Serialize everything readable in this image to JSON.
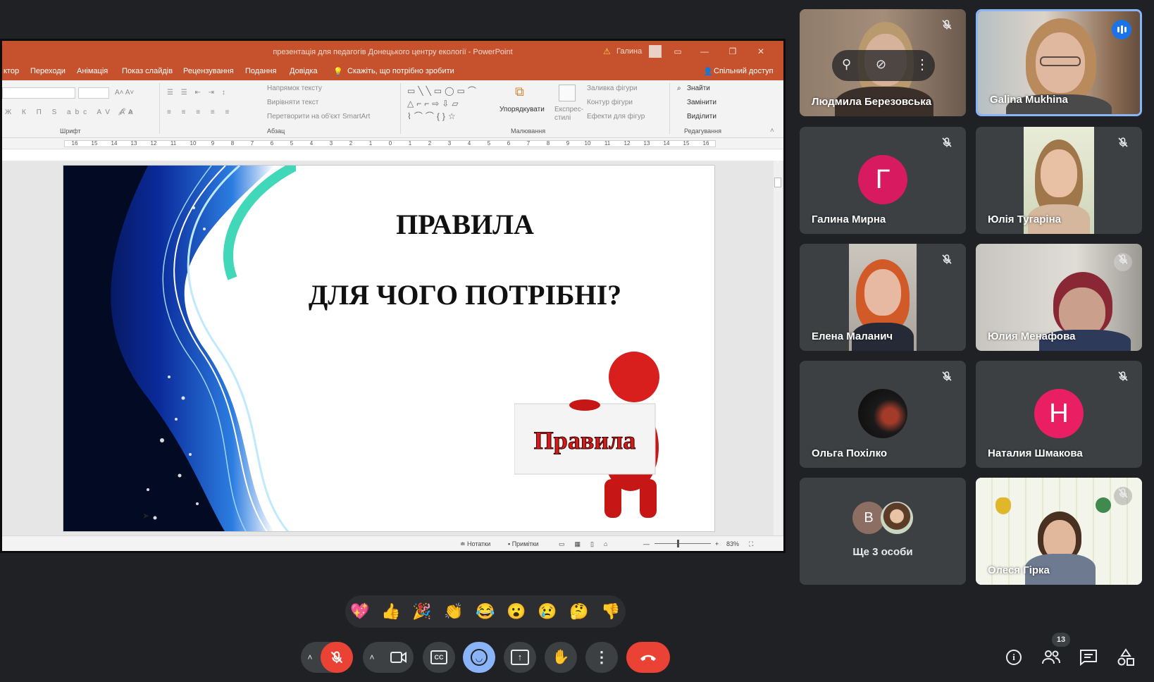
{
  "powerpoint": {
    "doc_title": "презентація для педагогів Донецького центру екології  -  PowerPoint",
    "user": "Галина",
    "menu": [
      "ктор",
      "Переходи",
      "Анімація",
      "Показ слайдів",
      "Рецензування",
      "Подання",
      "Довідка"
    ],
    "tell_me": "Скажіть, що потрібно зробити",
    "share": "Спільний доступ",
    "ribbon": {
      "group_font": "Шрифт",
      "group_paragraph": "Абзац",
      "group_drawing": "Малювання",
      "group_editing": "Редагування",
      "text_direction": "Напрямок тексту",
      "align_text": "Вирівняти текст",
      "smartart": "Перетворити на об'єкт SmartArt",
      "arrange": "Упорядкувати",
      "quick_styles": "Експрес-стилі",
      "shape_fill": "Заливка фігури",
      "shape_outline": "Контур фігури",
      "shape_effects": "Ефекти для фігур",
      "find": "Знайти",
      "replace": "Замінити",
      "select": "Виділити"
    },
    "ruler_ticks": [
      "16",
      "15",
      "14",
      "13",
      "12",
      "11",
      "10",
      "9",
      "8",
      "7",
      "6",
      "5",
      "4",
      "3",
      "2",
      "1",
      "0",
      "1",
      "2",
      "3",
      "4",
      "5",
      "6",
      "7",
      "8",
      "9",
      "10",
      "11",
      "12",
      "13",
      "14",
      "15",
      "16"
    ],
    "slide": {
      "title": "ПРАВИЛА",
      "question": "ДЛЯ ЧОГО ПОТРІБНІ?",
      "sign": "Правила"
    },
    "status": {
      "notes": "Нотатки",
      "comments": "Примітки",
      "zoom": "83%"
    }
  },
  "participants": [
    {
      "name": "Людмила Березовська",
      "muted": true,
      "pinned_controls": true
    },
    {
      "name": "Galina Mukhina",
      "speaking": true
    },
    {
      "name": "Галина Мирна",
      "letter": "Г",
      "color": "#d81b60",
      "muted": true
    },
    {
      "name": "Юлія Тугаріна",
      "muted": true
    },
    {
      "name": "Елена Маланич",
      "muted": true
    },
    {
      "name": "Юлия Менафова",
      "muted": true
    },
    {
      "name": "Ольга Похілко",
      "muted": true
    },
    {
      "name": "Наталия Шмакова",
      "letter": "Н",
      "color": "#e91e63",
      "muted": true
    },
    {
      "name": "Ще 3 особи",
      "letter": "В",
      "color": "#8d6e63"
    },
    {
      "name": "Олеся Гірка"
    }
  ],
  "reactions": [
    "💖",
    "👍",
    "🎉",
    "👏",
    "😂",
    "😮",
    "😢",
    "🤔",
    "👎"
  ],
  "controls": {
    "participant_count": "13",
    "icons": [
      "mic-off-icon",
      "camera-icon",
      "captions-icon",
      "emoji-icon",
      "present-icon",
      "raise-hand-icon",
      "more-icon",
      "end-call-icon",
      "info-icon",
      "people-icon",
      "chat-icon",
      "activities-icon"
    ]
  },
  "colors": {
    "accent": "#8ab4f8",
    "end_call": "#ea4335",
    "powerpoint": "#c6522d"
  }
}
